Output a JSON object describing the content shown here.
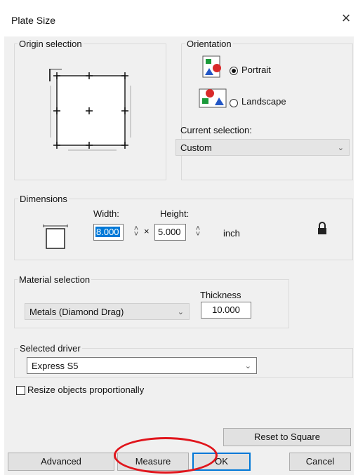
{
  "dialog": {
    "title": "Plate Size",
    "close_symbol": "×"
  },
  "origin": {
    "label": "Origin selection"
  },
  "orientation": {
    "label": "Orientation",
    "portrait_label": "Portrait",
    "landscape_label": "Landscape",
    "selected": "Portrait",
    "current_selection_label": "Current selection:",
    "current_selection_value": "Custom"
  },
  "dimensions": {
    "label": "Dimensions",
    "width_label": "Width:",
    "height_label": "Height:",
    "width_value": "8.000",
    "height_value": "5.000",
    "times_symbol": "×",
    "unit": "inch"
  },
  "material": {
    "label": "Material selection",
    "value": "Metals (Diamond Drag)",
    "thickness_label": "Thickness",
    "thickness_value": "10.000"
  },
  "driver": {
    "label": "Selected driver",
    "value": "Express S5"
  },
  "resize": {
    "label": "Resize objects proportionally",
    "checked": false
  },
  "buttons": {
    "reset": "Reset to Square",
    "advanced": "Advanced",
    "measure": "Measure",
    "ok": "OK",
    "cancel": "Cancel"
  },
  "icons": {
    "close": "close-icon",
    "portrait": "portrait-orientation-icon",
    "landscape": "landscape-orientation-icon",
    "lock": "lock-icon",
    "plate": "plate-outline-icon"
  },
  "colors": {
    "highlight_circle": "#e0151c",
    "default_button_border": "#0078d7",
    "selected_text_bg": "#0078d7"
  }
}
